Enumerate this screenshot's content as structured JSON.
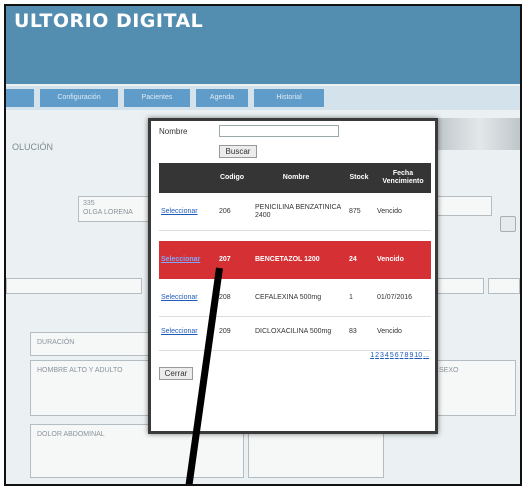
{
  "app": {
    "title": "ULTORIO DIGITAL"
  },
  "nav": {
    "items": [
      {
        "label": ""
      },
      {
        "label": "Configuración"
      },
      {
        "label": "Pacientes"
      },
      {
        "label": "Agenda"
      },
      {
        "label": "Historial"
      }
    ]
  },
  "page": {
    "section_title": "OLUCIÓN"
  },
  "background_form": {
    "field_values": [
      "335",
      "OLGA LORENA",
      "DURACIÓN",
      "HOMBRE ALTO Y ADULTO",
      "DOLOR ABDOMINAL",
      "SEXO"
    ]
  },
  "modal": {
    "search": {
      "label": "Nombre",
      "value": "",
      "button": "Buscar"
    },
    "table": {
      "columns": [
        "",
        "Codigo",
        "Nombre",
        "Stock",
        "Fecha Vencimiento"
      ],
      "rows": [
        {
          "action": "Seleccionar",
          "codigo": "206",
          "nombre": "PENICILINA BENZATINICA 2400",
          "stock": "875",
          "vencimiento": "Vencido",
          "selected": false
        },
        {
          "action": "Seleccionar",
          "codigo": "207",
          "nombre": "BENCETAZOL 1200",
          "stock": "24",
          "vencimiento": "Vencido",
          "selected": true
        },
        {
          "action": "Seleccionar",
          "codigo": "208",
          "nombre": "CEFALEXINA 500mg",
          "stock": "1",
          "vencimiento": "01/07/2016",
          "selected": false
        },
        {
          "action": "Seleccionar",
          "codigo": "209",
          "nombre": "DICLOXACILINA 500mg",
          "stock": "83",
          "vencimiento": "Vencido",
          "selected": false
        }
      ]
    },
    "pagination": [
      "1",
      "2",
      "3",
      "4",
      "5",
      "6",
      "7",
      "8",
      "9",
      "10",
      "..."
    ],
    "close_button": "Cerrar"
  },
  "colors": {
    "header": "#3c7ea6",
    "table_header": "#353535",
    "selected_row": "#d53034",
    "link": "#1f5bb8"
  }
}
